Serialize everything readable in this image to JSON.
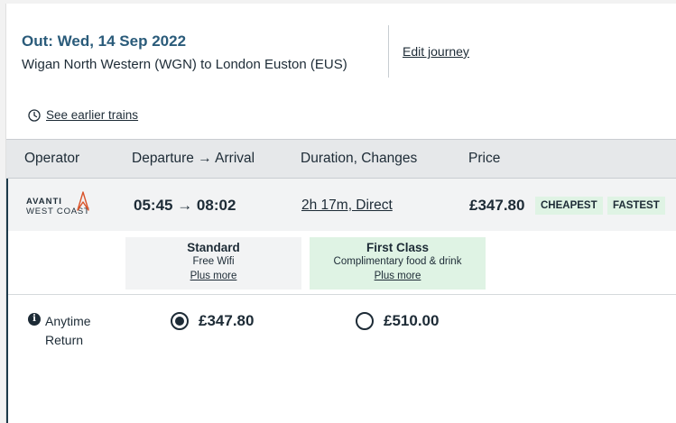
{
  "journey_header": {
    "title": "Out: Wed, 14 Sep 2022",
    "route": "Wigan North Western (WGN) to London Euston (EUS)",
    "edit_link": "Edit journey"
  },
  "earlier_trains": {
    "label": "See earlier trains",
    "icon": "clock-icon"
  },
  "columns": {
    "operator": "Operator",
    "departure_arrival": "Departure → Arrival",
    "duration_changes": "Duration, Changes",
    "price": "Price"
  },
  "train": {
    "operator_logo_line1": "AVANTI",
    "operator_logo_line2": "WEST COAST",
    "times": "05:45 → 08:02",
    "duration": "2h 17m, Direct",
    "price": "£347.80",
    "badges": [
      "CHEAPEST",
      "FASTEST"
    ]
  },
  "classes": [
    {
      "name": "Standard",
      "description": "Free Wifi",
      "more": "Plus more"
    },
    {
      "name": "First Class",
      "description": "Complimentary food & drink",
      "more": "Plus more"
    }
  ],
  "tickets": [
    {
      "name": "Anytime Return",
      "info_icon": "i",
      "fares": [
        {
          "price": "£347.80",
          "selected": true
        },
        {
          "price": "£510.00",
          "selected": false
        }
      ]
    }
  ],
  "colors": {
    "title": "#2a5b7a",
    "text": "#1d2b36",
    "badge_bg": "#dff3e4",
    "header_bg": "#e6e8ea",
    "row_bg": "#f2f3f4",
    "logo_accent": "#d9542b"
  }
}
